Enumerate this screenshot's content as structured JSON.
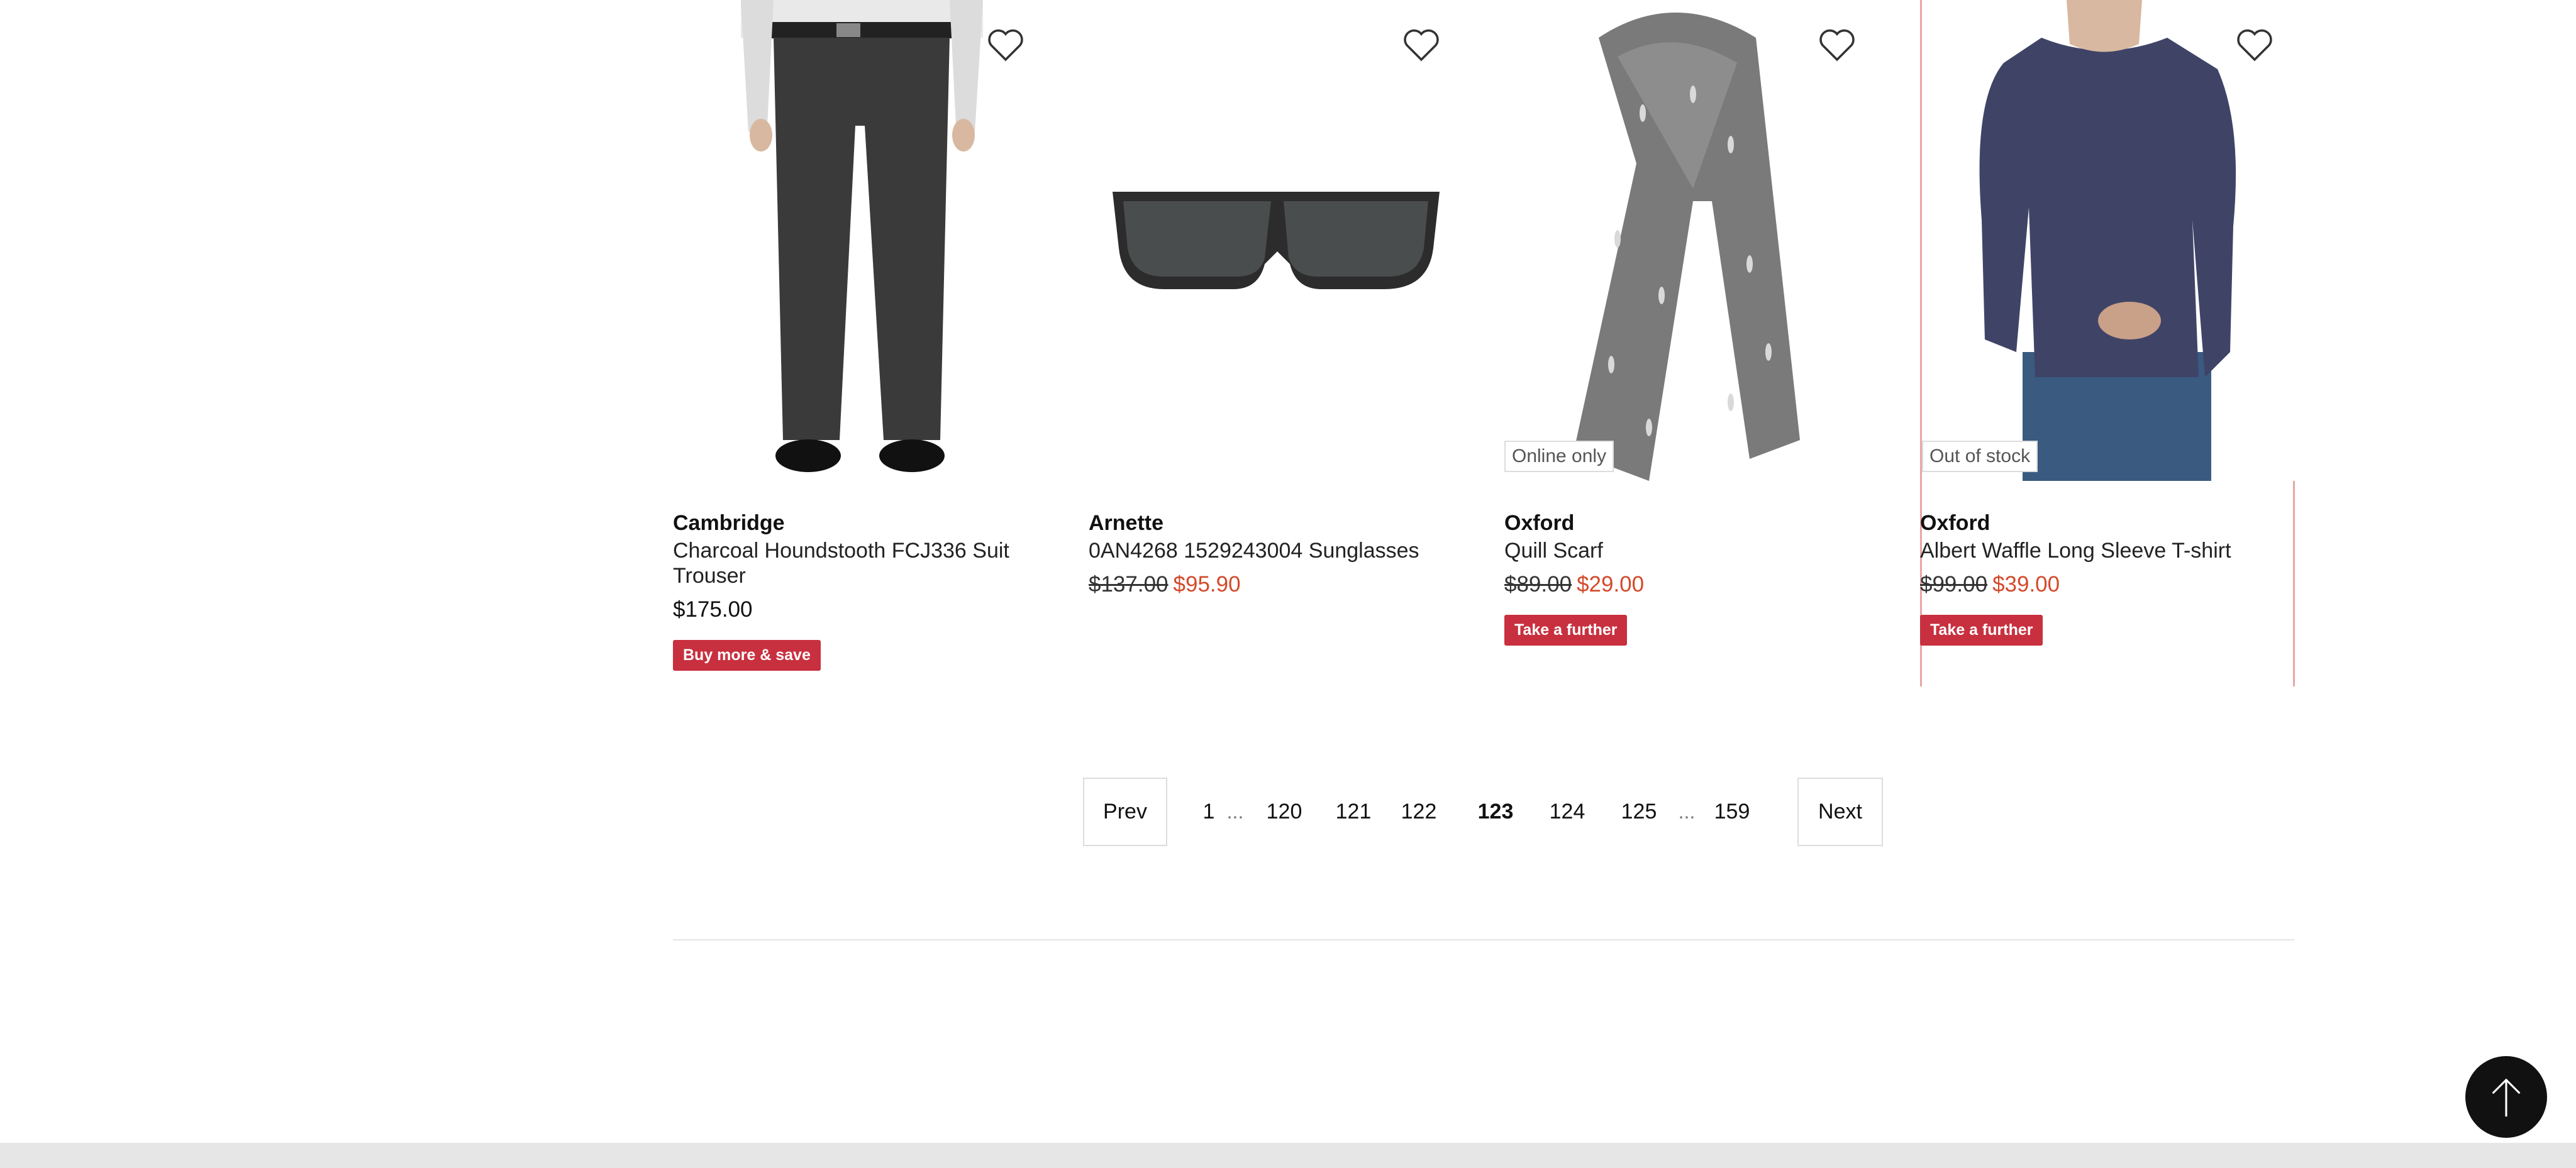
{
  "products": [
    {
      "brand": "Cambridge",
      "name": "Charcoal Houndstooth FCJ336 Suit Trouser",
      "price": "$175.00",
      "promo": "Buy more & save"
    },
    {
      "brand": "Arnette",
      "name": "0AN4268 1529243004 Sunglasses",
      "price_old": "$137.00",
      "price_new": "$95.90"
    },
    {
      "brand": "Oxford",
      "name": "Quill Scarf",
      "price_old": "$89.00",
      "price_new": "$29.00",
      "tag": "Online only",
      "promo": "Take a further"
    },
    {
      "brand": "Oxford",
      "name": "Albert Waffle Long Sleeve T-shirt",
      "price_old": "$99.00",
      "price_new": "$39.00",
      "tag": "Out of stock",
      "promo": "Take a further"
    }
  ],
  "pagination": {
    "prev": "Prev",
    "next": "Next",
    "pages": [
      "1",
      "120",
      "121",
      "122",
      "123",
      "124",
      "125",
      "159"
    ],
    "current": "123",
    "ellipsis": "..."
  },
  "colors": {
    "sale_price": "#d34a2a",
    "promo_badge": "#c8303f",
    "selected_card_border": "#e8a5a5"
  },
  "icons": {
    "wishlist": "heart-icon",
    "back_to_top": "arrow-up-icon"
  }
}
